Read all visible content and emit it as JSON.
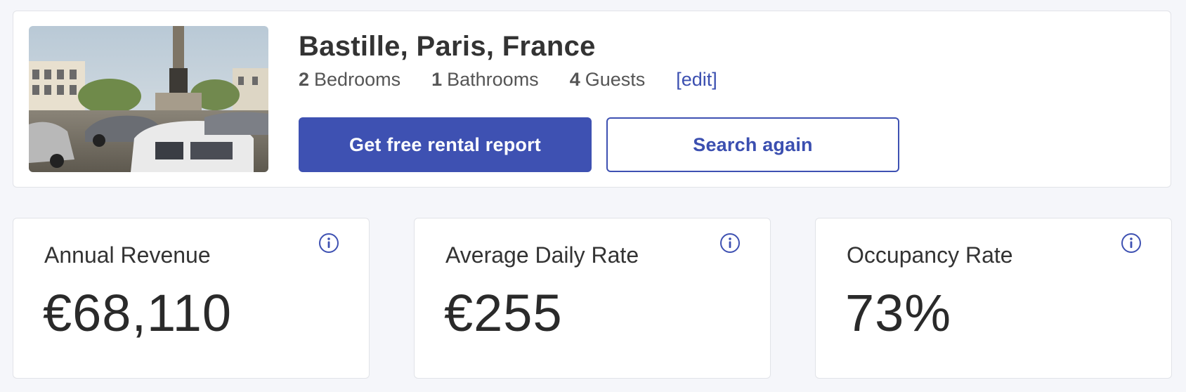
{
  "property": {
    "title": "Bastille, Paris, France",
    "bedrooms_count": "2",
    "bedrooms_label": "Bedrooms",
    "bathrooms_count": "1",
    "bathrooms_label": "Bathrooms",
    "guests_count": "4",
    "guests_label": "Guests",
    "edit_label": "[edit]",
    "image_icon": "street-view-photo"
  },
  "actions": {
    "primary_label": "Get free rental report",
    "secondary_label": "Search again"
  },
  "stats": [
    {
      "label": "Annual Revenue",
      "value": "€68,110",
      "icon": "info-icon"
    },
    {
      "label": "Average Daily Rate",
      "value": "€255",
      "icon": "info-icon"
    },
    {
      "label": "Occupancy Rate",
      "value": "73%",
      "icon": "info-icon"
    }
  ],
  "colors": {
    "accent": "#3e51b2",
    "link": "#3b4fb0",
    "background": "#f5f6fa",
    "card_border": "#e1e3e8"
  }
}
